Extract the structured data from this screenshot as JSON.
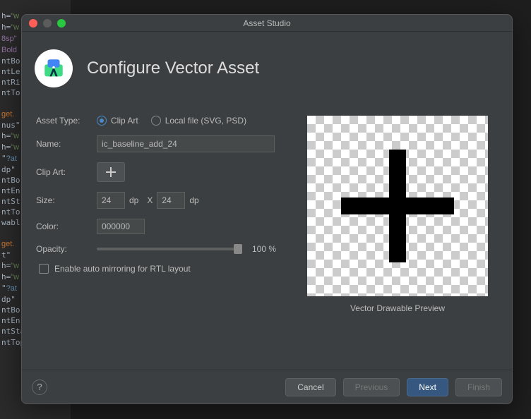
{
  "window": {
    "title": "Asset Studio"
  },
  "header": {
    "title": "Configure Vector Asset"
  },
  "form": {
    "assetTypeLabel": "Asset Type:",
    "assetType": {
      "clipArt": "Clip Art",
      "localFile": "Local file (SVG, PSD)",
      "selected": "clipArt"
    },
    "nameLabel": "Name:",
    "nameValue": "ic_baseline_add_24",
    "clipArtLabel": "Clip Art:",
    "clipArtIcon": "plus-icon",
    "sizeLabel": "Size:",
    "width": "24",
    "height": "24",
    "unit": "dp",
    "sizeSep": "X",
    "colorLabel": "Color:",
    "colorValue": "000000",
    "opacityLabel": "Opacity:",
    "opacityValue": "100 %",
    "rtlLabel": "Enable auto mirroring for RTL layout"
  },
  "preview": {
    "label": "Vector Drawable Preview"
  },
  "footer": {
    "help": "?",
    "cancel": "Cancel",
    "previous": "Previous",
    "next": "Next",
    "finish": "Finish"
  },
  "colors": {
    "accent": "#365880",
    "radioAccent": "#4a88c7"
  }
}
